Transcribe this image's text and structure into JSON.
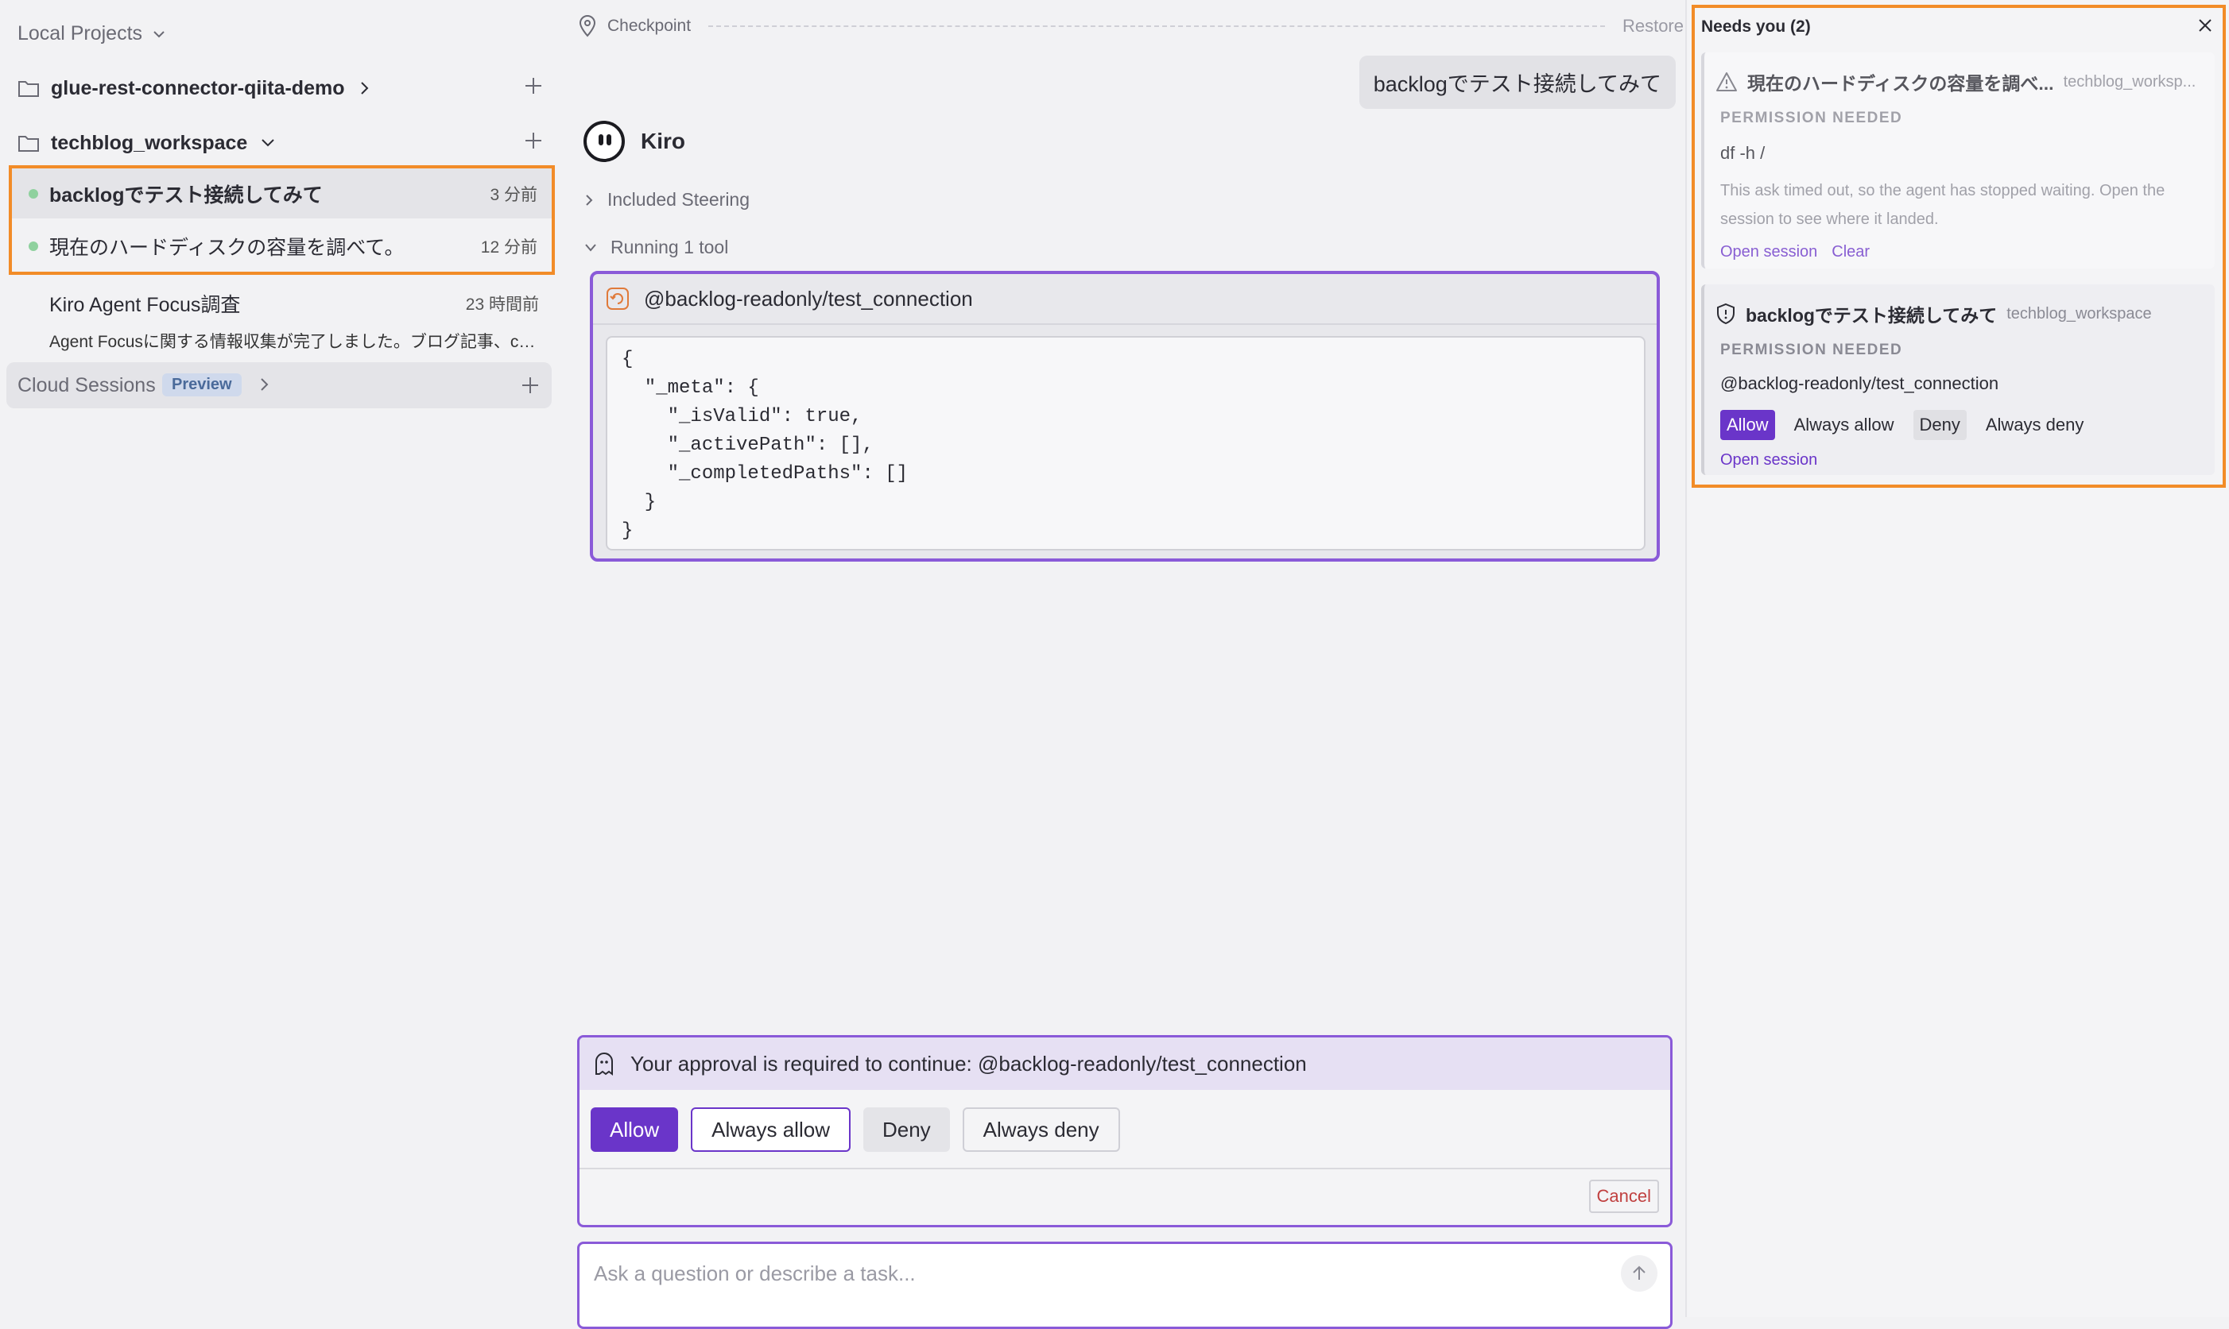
{
  "sidebar": {
    "header": "Local Projects",
    "projects": [
      {
        "name": "glue-rest-connector-qiita-demo"
      },
      {
        "name": "techblog_workspace"
      }
    ],
    "sessions": [
      {
        "title": "backlogでテスト接続してみて",
        "time": "3 分前"
      },
      {
        "title": "現在のハードディスクの容量を調べて。",
        "time": "12 分前"
      }
    ],
    "history": {
      "title": "Kiro Agent Focus調査",
      "time": "23 時間前",
      "subtitle": "Agent Focusに関する情報収集が完了しました。ブログ記事、cha..."
    },
    "cloud": {
      "label": "Cloud Sessions",
      "badge": "Preview"
    }
  },
  "main": {
    "checkpoint_label": "Checkpoint",
    "restore_label": "Restore",
    "user_message": "backlogでテスト接続してみて",
    "agent_name": "Kiro",
    "included_steering": "Included Steering",
    "running_tool": "Running 1 tool",
    "tool": {
      "name": "@backlog-readonly/test_connection",
      "json": "{\n  \"_meta\": {\n    \"_isValid\": true,\n    \"_activePath\": [],\n    \"_completedPaths\": []\n  }\n}"
    },
    "approval": {
      "text": "Your approval is required to continue: @backlog-readonly/test_connection",
      "allow": "Allow",
      "always_allow": "Always allow",
      "deny": "Deny",
      "always_deny": "Always deny",
      "cancel": "Cancel"
    },
    "input_placeholder": "Ask a question or describe a task..."
  },
  "needs_panel": {
    "title": "Needs you (2)",
    "cards": [
      {
        "title": "現在のハードディスクの容量を調べ...",
        "workspace": "techblog_worksp...",
        "permission": "PERMISSION NEEDED",
        "command": "df -h /",
        "message": "This ask timed out, so the agent has stopped waiting. Open the session to see where it landed.",
        "open_session": "Open session",
        "clear": "Clear"
      },
      {
        "title": "backlogでテスト接続してみて",
        "workspace": "techblog_workspace",
        "permission": "PERMISSION NEEDED",
        "command": "@backlog-readonly/test_connection",
        "allow": "Allow",
        "always_allow": "Always allow",
        "deny": "Deny",
        "always_deny": "Always deny",
        "open_session": "Open session"
      }
    ]
  },
  "colors": {
    "accent": "#6a35c9",
    "highlight": "#f28c28",
    "tool_border": "#8a5ad8",
    "status_dot": "#8fd19e"
  }
}
